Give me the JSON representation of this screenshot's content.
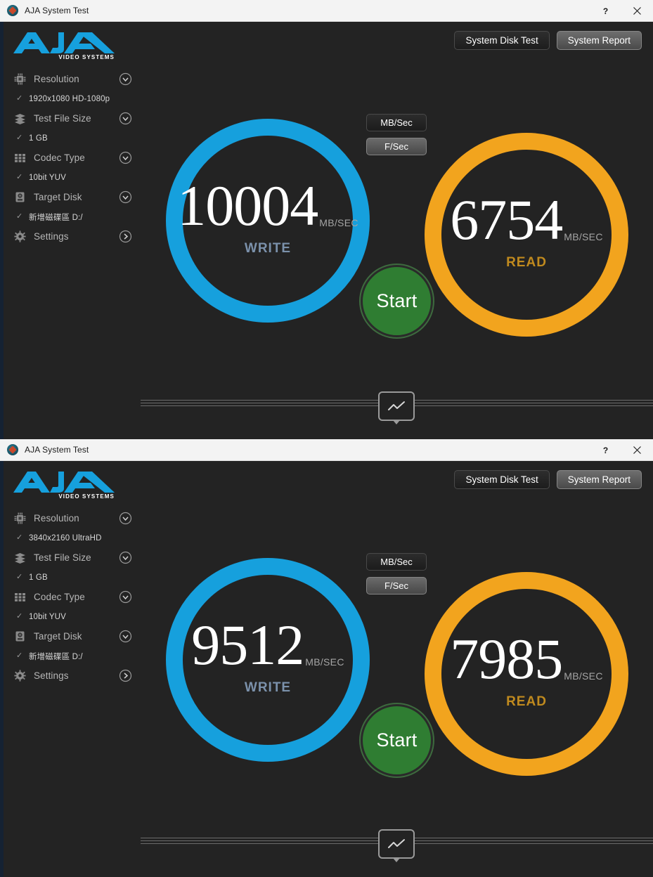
{
  "app": {
    "title": "AJA System Test",
    "icon": "aja-app-icon",
    "help_glyph": "?",
    "close_glyph": "close-icon"
  },
  "logo": {
    "wordmark": "AJA",
    "subtitle": "VIDEO SYSTEMS",
    "color": "#16a0dd"
  },
  "toolbar": {
    "system_disk_test": "System Disk Test",
    "system_report": "System Report",
    "active": "System Report"
  },
  "unit_toggle": {
    "mb_per_sec": "MB/Sec",
    "frames_per_sec": "F/Sec",
    "active": "F/Sec"
  },
  "start_button": {
    "label": "Start",
    "color": "#2f7d32"
  },
  "graph_toggle": {
    "name": "graph-expander",
    "icon": "line-chart-icon"
  },
  "windows": [
    {
      "sidebar": {
        "items": [
          {
            "icon": "chip-icon",
            "label": "Resolution",
            "value": "1920x1080 HD-1080p",
            "chevron": "chevron-down-icon"
          },
          {
            "icon": "layers-icon",
            "label": "Test File Size",
            "value": "1 GB",
            "chevron": "chevron-down-icon"
          },
          {
            "icon": "grid-icon",
            "label": "Codec Type",
            "value": "10bit YUV",
            "chevron": "chevron-down-icon"
          },
          {
            "icon": "disk-icon",
            "label": "Target Disk",
            "value": "新增磁碟區  D:/",
            "chevron": "chevron-down-icon"
          },
          {
            "icon": "gear-icon",
            "label": "Settings",
            "value": null,
            "chevron": "chevron-right-icon"
          }
        ]
      },
      "gauges": {
        "write": {
          "value": "10004",
          "unit": "MB/SEC",
          "label": "WRITE",
          "color": "#16a0dd"
        },
        "read": {
          "value": "6754",
          "unit": "MB/SEC",
          "label": "READ",
          "color": "#f2a41e"
        }
      }
    },
    {
      "sidebar": {
        "items": [
          {
            "icon": "chip-icon",
            "label": "Resolution",
            "value": "3840x2160 UltraHD",
            "chevron": "chevron-down-icon"
          },
          {
            "icon": "layers-icon",
            "label": "Test File Size",
            "value": "1 GB",
            "chevron": "chevron-down-icon"
          },
          {
            "icon": "grid-icon",
            "label": "Codec Type",
            "value": "10bit YUV",
            "chevron": "chevron-down-icon"
          },
          {
            "icon": "disk-icon",
            "label": "Target Disk",
            "value": "新增磁碟區  D:/",
            "chevron": "chevron-down-icon"
          },
          {
            "icon": "gear-icon",
            "label": "Settings",
            "value": null,
            "chevron": "chevron-right-icon"
          }
        ]
      },
      "gauges": {
        "write": {
          "value": "9512",
          "unit": "MB/SEC",
          "label": "WRITE",
          "color": "#16a0dd"
        },
        "read": {
          "value": "7985",
          "unit": "MB/SEC",
          "label": "READ",
          "color": "#f2a41e"
        }
      }
    }
  ]
}
